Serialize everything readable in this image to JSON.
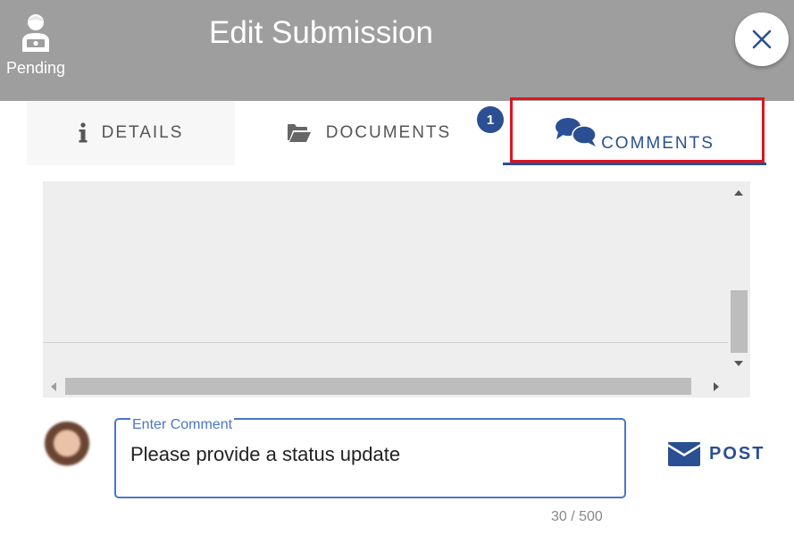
{
  "header": {
    "title": "Edit Submission",
    "status_label": "Pending",
    "status_icon": "person-money-icon",
    "close_icon": "close-icon",
    "background_color": "#9e9e9e"
  },
  "tabs": [
    {
      "label": "DETAILS",
      "icon": "info-icon",
      "active": false
    },
    {
      "label": "DOCUMENTS",
      "icon": "folder-open-icon",
      "active": false
    },
    {
      "label": "COMMENTS",
      "icon": "comments-icon",
      "active": true,
      "badge": "1"
    }
  ],
  "comment_form": {
    "label": "Enter Comment",
    "value": "Please provide a status update",
    "counter": "30 / 500",
    "post_label": "POST",
    "post_icon": "envelope-icon"
  },
  "colors": {
    "accent": "#2a4f93",
    "field_border": "#4a76c9",
    "highlight": "#e0141e"
  }
}
